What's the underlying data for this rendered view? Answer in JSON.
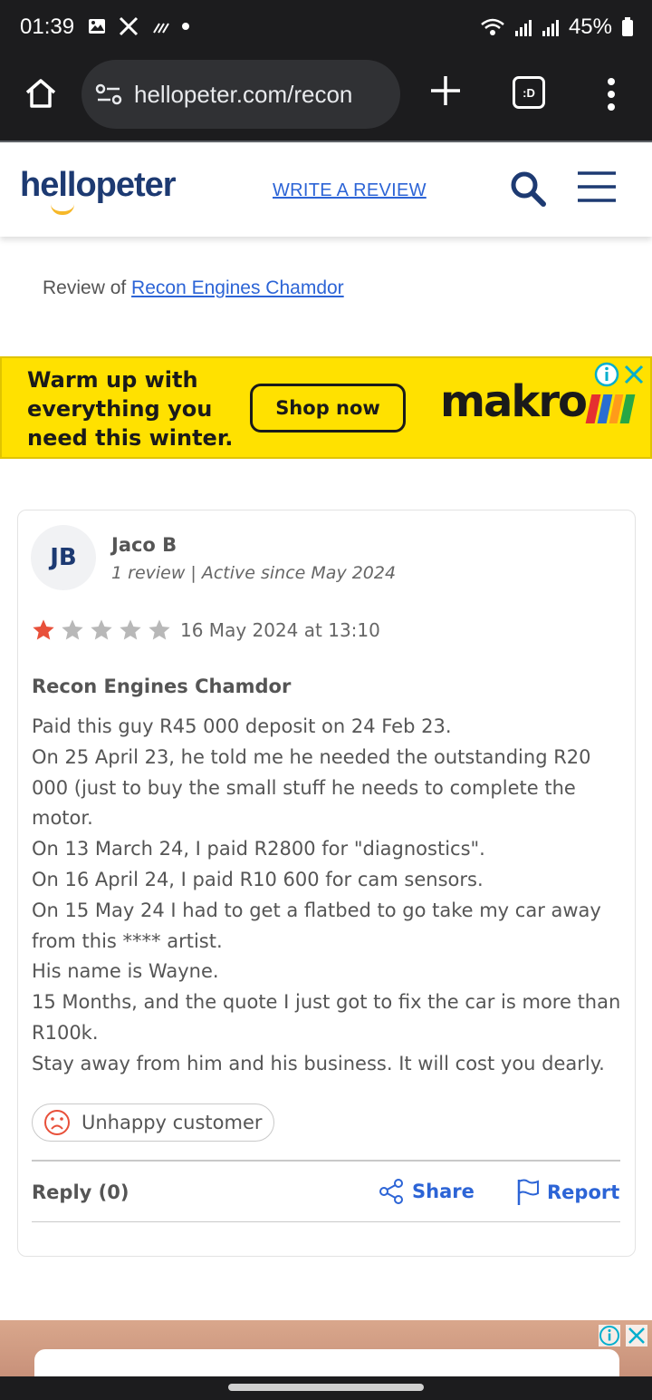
{
  "status_bar": {
    "time": "01:39",
    "battery": "45%"
  },
  "browser": {
    "url": "hellopeter.com/recon",
    "tabs_label": ":D"
  },
  "header": {
    "logo": "hellopeter",
    "write_review": "WRITE A REVIEW"
  },
  "breadcrumb": {
    "prefix": "Review of ",
    "business": "Recon Engines Chamdor"
  },
  "ad_top": {
    "line1": "Warm up with",
    "line2": "everything you",
    "line3": "need this winter.",
    "cta": "Shop now",
    "brand": "makro"
  },
  "review": {
    "initials": "JB",
    "name": "Jaco B",
    "meta": "1 review | Active since May 2024",
    "rating": 1,
    "rating_max": 5,
    "date": "16 May 2024 at 13:10",
    "title": "Recon Engines Chamdor",
    "body": [
      "Paid this guy R45 000 deposit on 24 Feb 23.",
      "On 25 April 23, he told me he needed the outstanding R20",
      "000 (just to buy the small stuff he needs to complete the",
      "motor.",
      "On 13 March 24, I paid R2800 for \"diagnostics\".",
      "On 16 April 24, I paid R10 600 for cam sensors.",
      "On 15 May 24 I had to get a flatbed to go take my car away",
      "from this **** artist.",
      "His name is Wayne.",
      "15 Months, and the quote I just got to fix the car is more than",
      "R100k.",
      "Stay away from him and his business. It will cost you dearly."
    ],
    "sentiment": "Unhappy customer",
    "reply": "Reply (0)",
    "share": "Share",
    "report": "Report"
  },
  "colors": {
    "brand_navy": "#1d3a72",
    "link_blue": "#2c64d6",
    "star_active": "#e8503a",
    "star_inactive": "#b8b8b8",
    "ad_yellow": "#ffe100"
  }
}
